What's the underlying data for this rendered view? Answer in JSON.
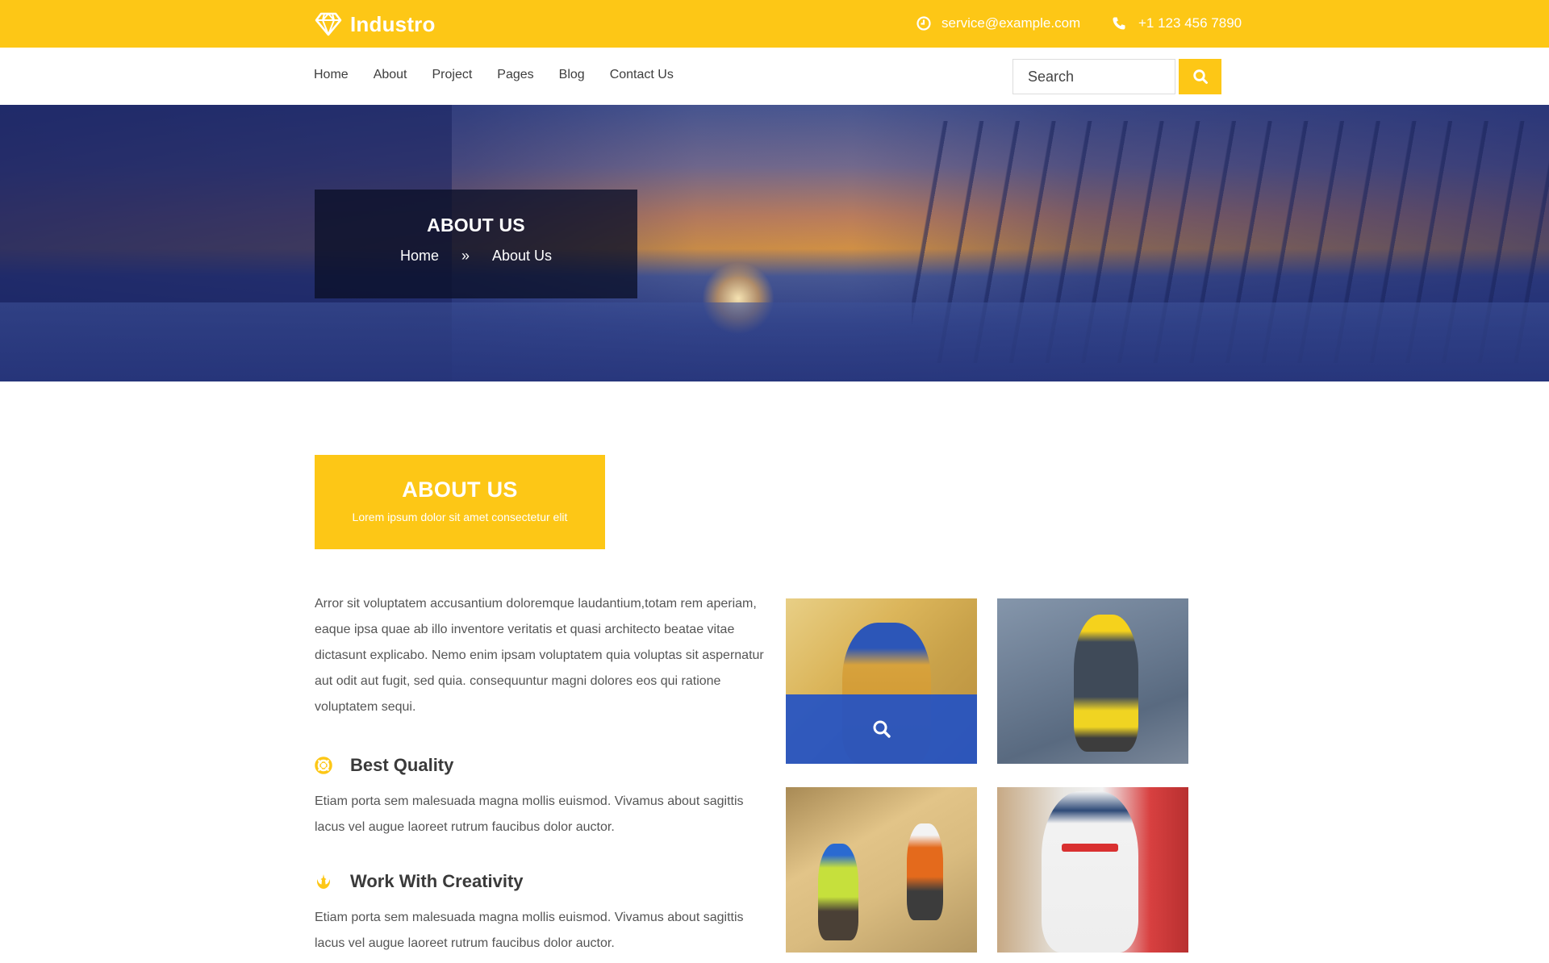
{
  "brand": {
    "name": "Industro",
    "logo_icon": "diamond-icon",
    "accent_color": "#FDC716",
    "overlay_color": "#1E50C8"
  },
  "topbar": {
    "email": {
      "icon": "clock-icon",
      "text": "service@example.com"
    },
    "phone": {
      "icon": "phone-icon",
      "text": "+1 123 456 7890"
    }
  },
  "nav": {
    "items": [
      {
        "label": "Home"
      },
      {
        "label": "About"
      },
      {
        "label": "Project"
      },
      {
        "label": "Pages"
      },
      {
        "label": "Blog"
      },
      {
        "label": "Contact Us"
      }
    ],
    "search": {
      "placeholder": "Search",
      "value": "",
      "button_icon": "search-icon"
    }
  },
  "hero": {
    "title": "ABOUT US",
    "breadcrumb": {
      "home": "Home",
      "separator": "»",
      "current": "About Us"
    }
  },
  "about": {
    "title": "ABOUT US",
    "subtitle": "Lorem ipsum dolor sit amet consectetur elit",
    "intro": "Arror sit voluptatem accusantium doloremque laudantium,totam rem aperiam, eaque ipsa quae ab illo inventore veritatis et quasi architecto beatae vitae dictasunt explicabo. Nemo enim ipsam voluptatem quia voluptas sit aspernatur aut odit aut fugit, sed quia. consequuntur magni dolores eos qui ratione voluptatem sequi.",
    "features": [
      {
        "icon": "lifebuoy-icon",
        "title": "Best Quality",
        "text": "Etiam porta sem malesuada magna mollis euismod. Vivamus about sagittis lacus vel augue laoreet rutrum faucibus dolor auctor."
      },
      {
        "icon": "rebel-icon",
        "title": "Work With Creativity",
        "text": "Etiam porta sem malesuada magna mollis euismod. Vivamus about sagittis lacus vel augue laoreet rutrum faucibus dolor auctor."
      }
    ]
  },
  "gallery": {
    "images": [
      {
        "subject": "firefighter in yellow gear and blue helmet",
        "hover_icon": "search-icon",
        "hovered": true
      },
      {
        "subject": "rope-access worker cleaning glass facade"
      },
      {
        "subject": "construction workers with table saw"
      },
      {
        "subject": "worker in white protective suit with chemicals"
      }
    ]
  }
}
